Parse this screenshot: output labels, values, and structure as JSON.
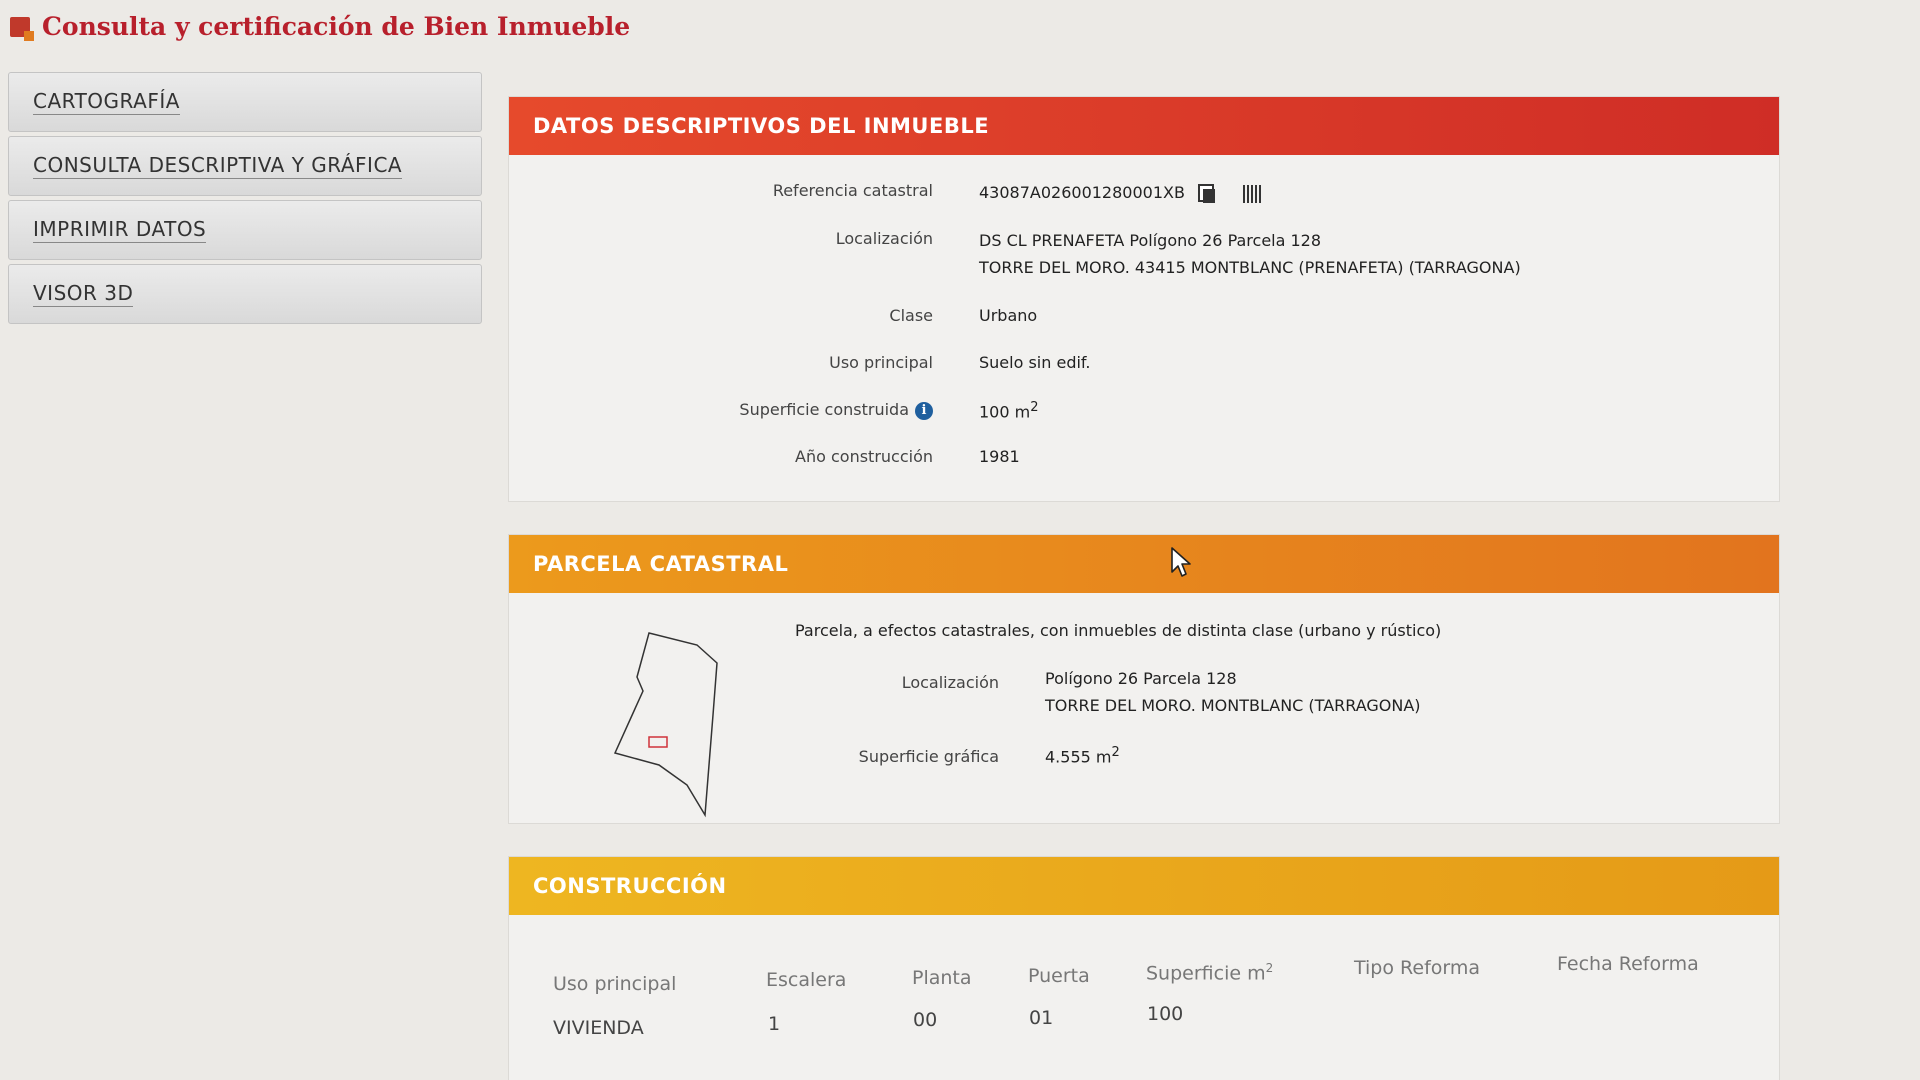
{
  "page": {
    "title": "Consulta y certificación de Bien Inmueble"
  },
  "sidebar": {
    "items": [
      {
        "label": "CARTOGRAFÍA"
      },
      {
        "label": "CONSULTA DESCRIPTIVA Y GRÁFICA"
      },
      {
        "label": "IMPRIMIR DATOS"
      },
      {
        "label": "VISOR 3D"
      }
    ]
  },
  "datos": {
    "header": "DATOS DESCRIPTIVOS DEL INMUEBLE",
    "referencia_label": "Referencia catastral",
    "referencia_value": "43087A026001280001XB",
    "localizacion_label": "Localización",
    "localizacion_line1": "DS CL PRENAFETA Polígono 26 Parcela 128",
    "localizacion_line2": "TORRE DEL MORO. 43415 MONTBLANC (PRENAFETA) (TARRAGONA)",
    "clase_label": "Clase",
    "clase_value": "Urbano",
    "uso_label": "Uso principal",
    "uso_value": "Suelo sin edif.",
    "superficie_label": "Superficie construida",
    "superficie_value": "100 m",
    "superficie_unit_sup": "2",
    "ano_label": "Año construcción",
    "ano_value": "1981"
  },
  "parcela": {
    "header": "PARCELA CATASTRAL",
    "description": "Parcela, a efectos catastrales, con inmuebles de distinta clase (urbano y rústico)",
    "localizacion_label": "Localización",
    "localizacion_line1": "Polígono 26 Parcela 128",
    "localizacion_line2": "TORRE DEL MORO. MONTBLANC (TARRAGONA)",
    "superficie_label": "Superficie gráfica",
    "superficie_value": "4.555 m",
    "superficie_unit_sup": "2"
  },
  "construccion": {
    "header": "CONSTRUCCIÓN",
    "columns": [
      "Uso principal",
      "Escalera",
      "Planta",
      "Puerta",
      "Superficie m",
      "Tipo Reforma",
      "Fecha Reforma"
    ],
    "superficie_sup": "2",
    "rows": [
      {
        "uso": "VIVIENDA",
        "escalera": "1",
        "planta": "00",
        "puerta": "01",
        "superficie": "100",
        "tipo_reforma": "",
        "fecha_reforma": ""
      }
    ]
  },
  "colors": {
    "title": "#b8202c",
    "header_red": "#d9352a",
    "header_orange": "#e8871e",
    "header_yellow": "#eaa81c",
    "info_icon": "#1f5f9e"
  },
  "icons": [
    "title-logo-icon",
    "copy-icon",
    "barcode-icon",
    "info-icon",
    "mouse-cursor-icon"
  ]
}
